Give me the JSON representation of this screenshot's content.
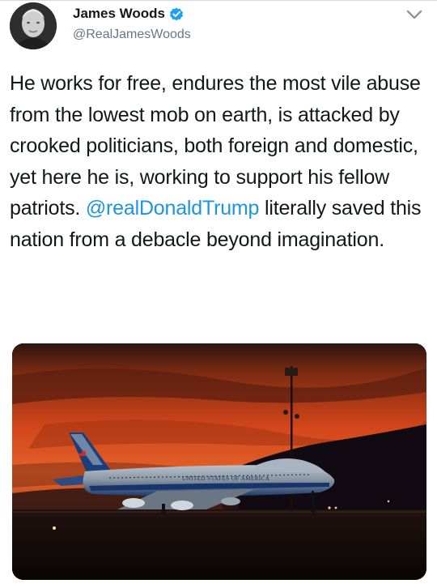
{
  "author": {
    "display_name": "James Woods",
    "handle": "@RealJamesWoods"
  },
  "icons": {
    "verified": "verified-badge-icon",
    "menu": "chevron-down-icon"
  },
  "colors": {
    "accent": "#1b95e0",
    "text": "#14171a",
    "muted": "#657786"
  },
  "tweet": {
    "text_before": "He works for free, endures the most vile abuse from the lowest mob on earth, is attacked by crooked politicians, both foreign and domestic, yet here he is, working to support his fellow patriots. ",
    "mention": "@realDonaldTrump",
    "text_after": " literally saved this nation from a debacle beyond imagination."
  },
  "media": {
    "aircraft_livery_text": "UNITED STATES OF AMERICA"
  }
}
